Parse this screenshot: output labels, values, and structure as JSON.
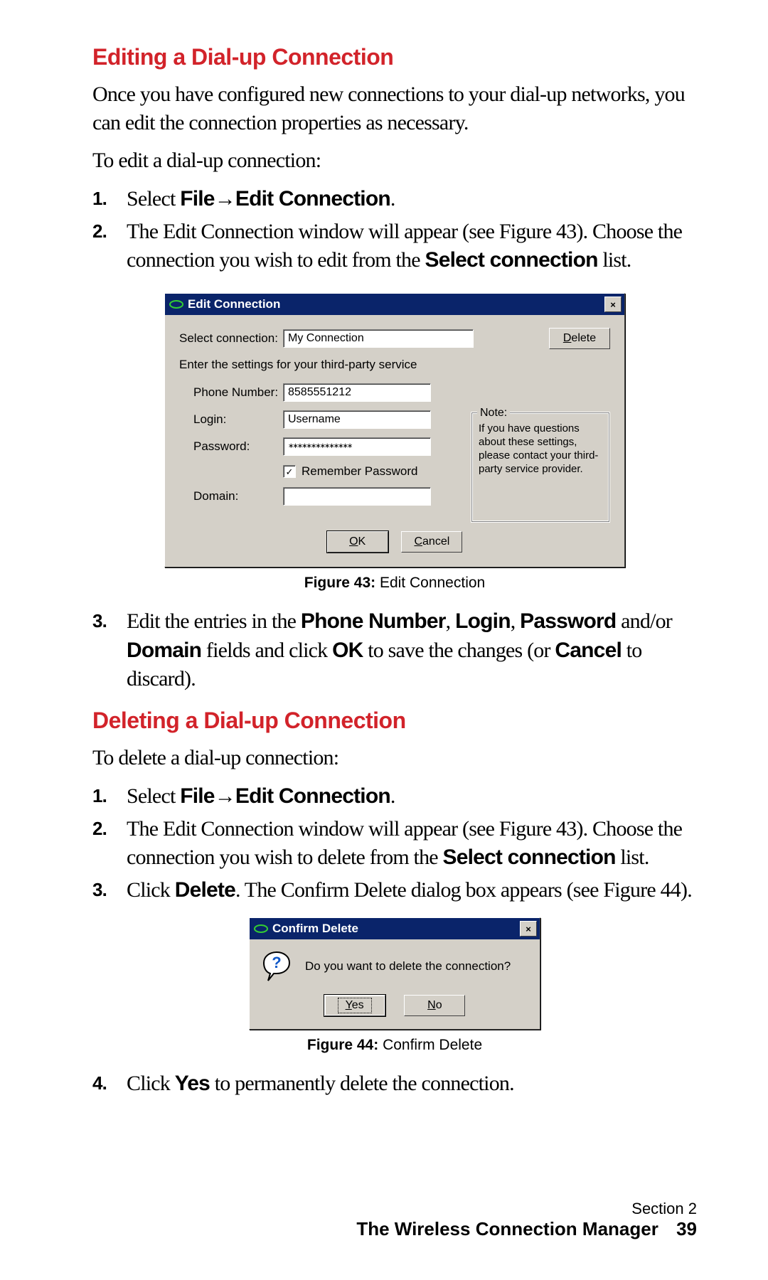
{
  "section1": {
    "heading": "Editing a Dial-up Connection",
    "p1": "Once you have configured new connections to your dial-up networks, you can edit the connection properties as necessary.",
    "p2": "To edit a dial-up connection:",
    "steps": {
      "s1_a": "Select ",
      "s1_b1": "File",
      "s1_arrow": "→",
      "s1_b2": "Edit Connection",
      "s1_c": ".",
      "s2_a": "The Edit Connection window will appear (see Figure 43). Choose the connection you wish to edit from the ",
      "s2_b": "Select connection",
      "s2_c": " list.",
      "s3_a": "Edit the entries in the ",
      "s3_b1": "Phone Number",
      "s3_p1": ", ",
      "s3_b2": "Login",
      "s3_p2": ", ",
      "s3_b3": "Password",
      "s3_p3": " and/or ",
      "s3_b4": "Domain",
      "s3_p4": " fields and click ",
      "s3_b5": "OK",
      "s3_p5": " to save the changes (or ",
      "s3_b6": "Cancel",
      "s3_p6": " to discard)."
    }
  },
  "dialog1": {
    "title": "Edit Connection",
    "close": "×",
    "select_label": "Select connection:",
    "select_value": "My Connection",
    "delete": "Delete",
    "delete_u": "D",
    "instruct": "Enter the settings for your third-party service",
    "phone_label": "Phone Number:",
    "phone_value": "8585551212",
    "login_label": "Login:",
    "login_value": "Username",
    "pass_label": "Password:",
    "pass_value": "∗∗∗∗∗∗∗∗∗∗∗∗∗∗",
    "remember": "Remember Password",
    "domain_label": "Domain:",
    "note_legend": "Note:",
    "note_text": "If you have questions about these settings, please contact your third-party service provider.",
    "ok": "OK",
    "ok_u": "O",
    "ok_rest": "K",
    "cancel": "Cancel",
    "cancel_u": "C",
    "cancel_rest": "ancel"
  },
  "caption1": {
    "b": "Figure 43:",
    "t": " Edit Connection"
  },
  "section2": {
    "heading": "Deleting a Dial-up Connection",
    "p1": "To delete a dial-up connection:",
    "steps": {
      "s1_a": "Select ",
      "s1_b1": "File",
      "s1_arrow": "→",
      "s1_b2": "Edit Connection",
      "s1_c": ".",
      "s2_a": "The Edit Connection window will appear (see Figure 43). Choose the connection you wish to delete from the ",
      "s2_b": "Select connection",
      "s2_c": " list.",
      "s3_a": "Click ",
      "s3_b1": "Delete",
      "s3_p1": ". The Confirm Delete dialog box appears (see Figure 44).",
      "s4_a": "Click ",
      "s4_b1": "Yes",
      "s4_p1": " to permanently delete the connection."
    }
  },
  "dialog2": {
    "title": "Confirm Delete",
    "close": "×",
    "msg": "Do you want to delete the connection?",
    "yes_u": "Y",
    "yes_rest": "es",
    "no_u": "N",
    "no_rest": "o"
  },
  "caption2": {
    "b": "Figure 44:",
    "t": " Confirm Delete"
  },
  "footer": {
    "section": "Section 2",
    "title": "The Wireless Connection Manager",
    "page": "39"
  },
  "nums": {
    "n1": "1.",
    "n2": "2.",
    "n3": "3.",
    "n4": "4."
  }
}
